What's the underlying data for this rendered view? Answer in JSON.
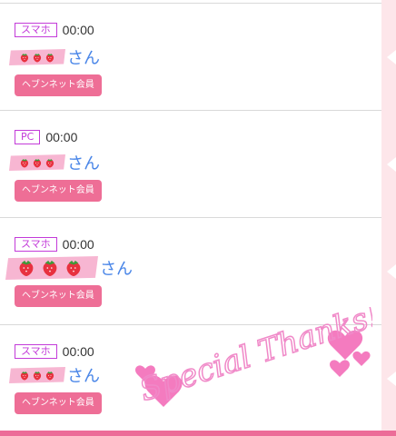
{
  "entries": [
    {
      "device": "スマホ",
      "time": "00:00",
      "name_suffix": "さん",
      "badge": "ヘブンネット会員",
      "icon": "strawberry-icon"
    },
    {
      "device": "PC",
      "time": "00:00",
      "name_suffix": "さん",
      "badge": "ヘブンネット会員",
      "icon": "strawberry-icon"
    },
    {
      "device": "スマホ",
      "time": "00:00",
      "name_suffix": "さん",
      "badge": "ヘブンネット会員",
      "icon": "strawberry-icon"
    },
    {
      "device": "スマホ",
      "time": "00:00",
      "name_suffix": "さん",
      "badge": "ヘブンネット会員",
      "icon": "strawberry-icon"
    }
  ],
  "decoration": {
    "text": "Special Thanks!!",
    "icon": "hearts-icon"
  },
  "colors": {
    "device_badge": "#c33bd9",
    "member_badge": "#ee6e96",
    "name_text": "#4a86e8",
    "tape": "#f7b6d2",
    "accent_bar": "#ec6c98"
  }
}
